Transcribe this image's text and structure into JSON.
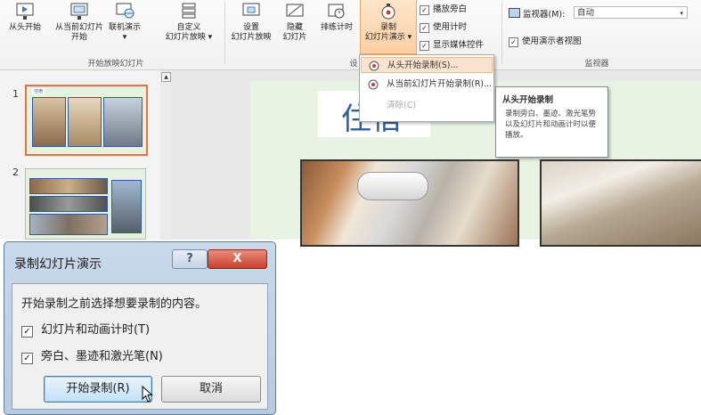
{
  "ribbon": {
    "buttons": [
      {
        "label1": "从头开始",
        "label2": ""
      },
      {
        "label1": "从当前幻灯片",
        "label2": "开始"
      },
      {
        "label1": "联机演示",
        "label2": "▾"
      },
      {
        "label1": "自定义",
        "label2": "幻灯片放映 ▾"
      },
      {
        "label1": "设置",
        "label2": "幻灯片放映"
      },
      {
        "label1": "隐藏",
        "label2": "幻灯片"
      },
      {
        "label1": "排练计时",
        "label2": ""
      },
      {
        "label1": "录制",
        "label2": "幻灯片演示 ▾"
      }
    ],
    "group_start_label": "开始放映幻灯片",
    "group_setup_label_partial": "设",
    "group_monitor_label": "监视器",
    "checkboxes": [
      {
        "label": "播放旁白",
        "checked": true
      },
      {
        "label": "使用计时",
        "checked": true
      },
      {
        "label": "显示媒体控件",
        "checked": true
      }
    ],
    "monitor_label": "监视器(M):",
    "monitor_value": "自动",
    "presenter_view_label": "使用演示者视图",
    "presenter_view_checked": true
  },
  "thumbnails": [
    {
      "number": "1",
      "caption": "住宿"
    },
    {
      "number": "2",
      "caption": ""
    }
  ],
  "slide": {
    "title": "住宿"
  },
  "dropdown_menu": {
    "items": [
      {
        "label": "从头开始录制(S)...",
        "highlighted": true,
        "disabled": false
      },
      {
        "label": "从当前幻灯片开始录制(R)...",
        "highlighted": false,
        "disabled": false
      },
      {
        "label": "清除(C)",
        "highlighted": false,
        "disabled": true
      }
    ]
  },
  "tooltip": {
    "title": "从头开始录制",
    "body": "录制旁白、墨迹、激光笔势以及幻灯片和动画计时以便播放。"
  },
  "dialog": {
    "title": "录制幻灯片演示",
    "help": "?",
    "close": "X",
    "prompt": "开始录制之前选择想要录制的内容。",
    "options": [
      {
        "label": "幻灯片和动画计时(T)",
        "checked": true
      },
      {
        "label": "旁白、墨迹和激光笔(N)",
        "checked": true
      }
    ],
    "start_button": "开始录制(R)",
    "cancel_button": "取消"
  },
  "colors": {
    "accent": "#e8743b",
    "title_blue": "#2f5f9a",
    "slide_bg": "#e9f3e3"
  }
}
